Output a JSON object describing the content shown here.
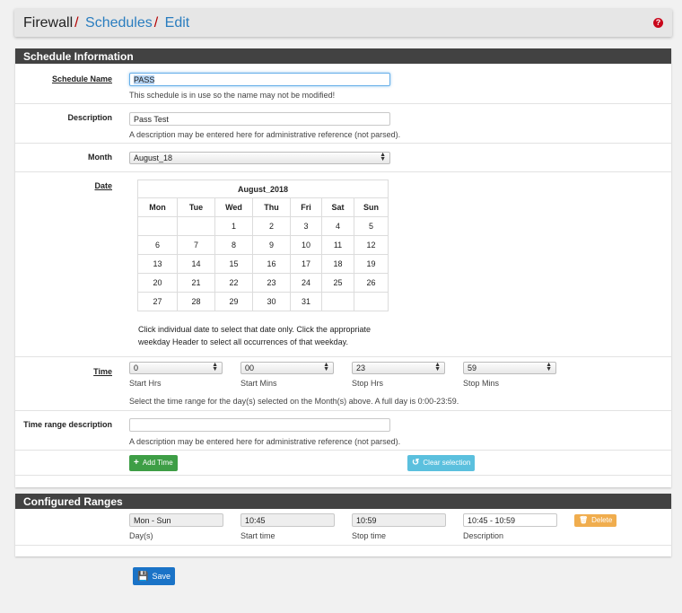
{
  "header": {
    "crumb1": "Firewall",
    "sep": "/",
    "crumb2": "Schedules",
    "crumb3": "Edit",
    "help": "?"
  },
  "schedule_info": {
    "heading": "Schedule Information",
    "name_label": "Schedule Name",
    "name_value": "PASS",
    "name_help": "This schedule is in use so the name may not be modified!",
    "desc_label": "Description",
    "desc_value": "Pass Test",
    "desc_help": "A description may be entered here for administrative reference (not parsed).",
    "month_label": "Month",
    "month_value": "August_18",
    "date_label": "Date",
    "calendar": {
      "title": "August_2018",
      "weekdays": [
        "Mon",
        "Tue",
        "Wed",
        "Thu",
        "Fri",
        "Sat",
        "Sun"
      ],
      "weeks": [
        [
          "",
          "",
          "1",
          "2",
          "3",
          "4",
          "5"
        ],
        [
          "6",
          "7",
          "8",
          "9",
          "10",
          "11",
          "12"
        ],
        [
          "13",
          "14",
          "15",
          "16",
          "17",
          "18",
          "19"
        ],
        [
          "20",
          "21",
          "22",
          "23",
          "24",
          "25",
          "26"
        ],
        [
          "27",
          "28",
          "29",
          "30",
          "31",
          "",
          ""
        ]
      ]
    },
    "date_help_1": "Click individual date to select that date only. Click the appropriate",
    "date_help_2": "weekday Header to select all occurrences of that weekday.",
    "time_label": "Time",
    "start_hrs": "0",
    "start_hrs_label": "Start Hrs",
    "start_mins": "00",
    "start_mins_label": "Start Mins",
    "stop_hrs": "23",
    "stop_hrs_label": "Stop Hrs",
    "stop_mins": "59",
    "stop_mins_label": "Stop Mins",
    "time_help": "Select the time range for the day(s) selected on the Month(s) above. A full day is 0:00-23:59.",
    "trange_label": "Time range description",
    "trange_value": "",
    "trange_help": "A description may be entered here for administrative reference (not parsed).",
    "add_time": "Add Time",
    "clear_selection": "Clear selection"
  },
  "configured": {
    "heading": "Configured Ranges",
    "days": "Mon - Sun",
    "days_label": "Day(s)",
    "start": "10:45",
    "start_label": "Start time",
    "stop": "10:59",
    "stop_label": "Stop time",
    "desc": "10:45 - 10:59",
    "desc_label": "Description",
    "delete": "Delete"
  },
  "save": "Save",
  "colors": {
    "heading_bg": "#424242",
    "link": "#2a7dbf",
    "separator": "#b40000",
    "add": "#3e9e46",
    "clear": "#5bc0de",
    "delete": "#f0ad4e",
    "save": "#1a73c7"
  }
}
